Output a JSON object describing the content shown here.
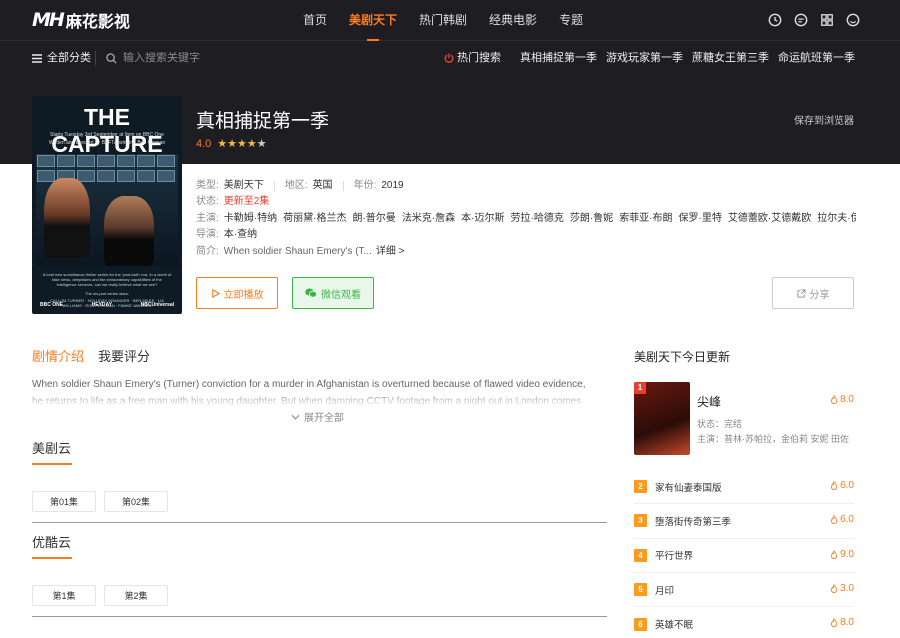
{
  "header": {
    "logo_mark": "MH",
    "logo_text": "麻花影视",
    "nav": [
      "首页",
      "美剧天下",
      "热门韩剧",
      "经典电影",
      "专题"
    ],
    "nav_active_index": 1,
    "icons": [
      "history-icon",
      "message-icon",
      "grid-icon",
      "smile-icon"
    ]
  },
  "subbar": {
    "category_label": "全部分类",
    "search_placeholder": "输入搜索关键字",
    "hot_label": "热门搜索",
    "hot_items": [
      "真相捕捉第一季",
      "游戏玩家第一季",
      "蔗糖女王第三季",
      "命运航班第一季"
    ]
  },
  "poster": {
    "title": "THE CAPTURE",
    "line1": "Starts Tuesday 3rd September at 9pm on BBC One",
    "line2": "Written and directed by BAFTA-winning Ben Chanan",
    "blurb": "A bold new surveillance thriller series for the 'post-truth' era. In a world of fake news, deepfakes and the extraordinary capabilities of the intelligence services, can we really believe what we see?",
    "tagline": "The six-part series stars:",
    "cast": "CALLUM TURNER · HOLLIDAY GRAINGER · BEN MILES · LIA WILLIAMS · RON PERLMAN · FAMKE JANSSEN",
    "foot": [
      "BBC ONE",
      "HEYDAY",
      "NBCUniversal"
    ]
  },
  "show": {
    "title": "真相捕捉第一季",
    "score": "4.0",
    "stars_filled": 4,
    "save_label": "保存到浏览器",
    "type_label": "类型:",
    "type": "美剧天下",
    "region_label": "地区:",
    "region": "英国",
    "year_label": "年份:",
    "year": "2019",
    "status_label": "状态:",
    "status": "更新至2集",
    "cast_label": "主演:",
    "cast": [
      "卡勒姆·特纳",
      "荷丽黛·格兰杰",
      "朗·普尔曼",
      "法米克·詹森",
      "本·迈尔斯",
      "劳拉·哈德克",
      "莎朗·鲁妮",
      "索菲亚·布朗",
      "保罗·里特",
      "艾德蕾欧·艾德戴欧",
      "拉尔夫·伊内..."
    ],
    "director_label": "导演:",
    "director": "本·查纳",
    "intro_label": "简介:",
    "intro": "When soldier Shaun Emery's (T...",
    "intro_more": "详细 >",
    "play_label": "立即播放",
    "wechat_label": "微信观看",
    "share_label": "分享"
  },
  "tabs": [
    "剧情介绍",
    "我要评分"
  ],
  "plot": {
    "text": "When soldier Shaun Emery's (Turner) conviction for a murder in Afghanistan is overturned because of flawed video evidence, he returns to life as a free man with his young daughter. But when damning CCTV footage from a night out in London comes to light,",
    "expand_label": "展开全部"
  },
  "sources": [
    {
      "name": "美剧云",
      "episodes": [
        "第01集",
        "第02集"
      ]
    },
    {
      "name": "优酷云",
      "episodes": [
        "第1集",
        "第2集"
      ]
    }
  ],
  "sidebar": {
    "title": "美剧天下今日更新",
    "top": {
      "rank": "1",
      "name": "尖峰",
      "score": "8.0",
      "status": "状态：完结",
      "cast": "主演：普林·苏帕拉，金伯莉 安妮 田佐"
    },
    "list": [
      {
        "rank": "2",
        "name": "家有仙妻泰国版",
        "score": "6.0"
      },
      {
        "rank": "3",
        "name": "堕落街传奇第三季",
        "score": "6.0"
      },
      {
        "rank": "4",
        "name": "平行世界",
        "score": "9.0"
      },
      {
        "rank": "5",
        "name": "月印",
        "score": "3.0"
      },
      {
        "rank": "6",
        "name": "英雄不眠",
        "score": "8.0"
      }
    ]
  },
  "colors": {
    "accent": "#ff7a1c",
    "dark": "#1e1d22",
    "wechat": "#3bb54a",
    "status_red": "#e8402e"
  }
}
